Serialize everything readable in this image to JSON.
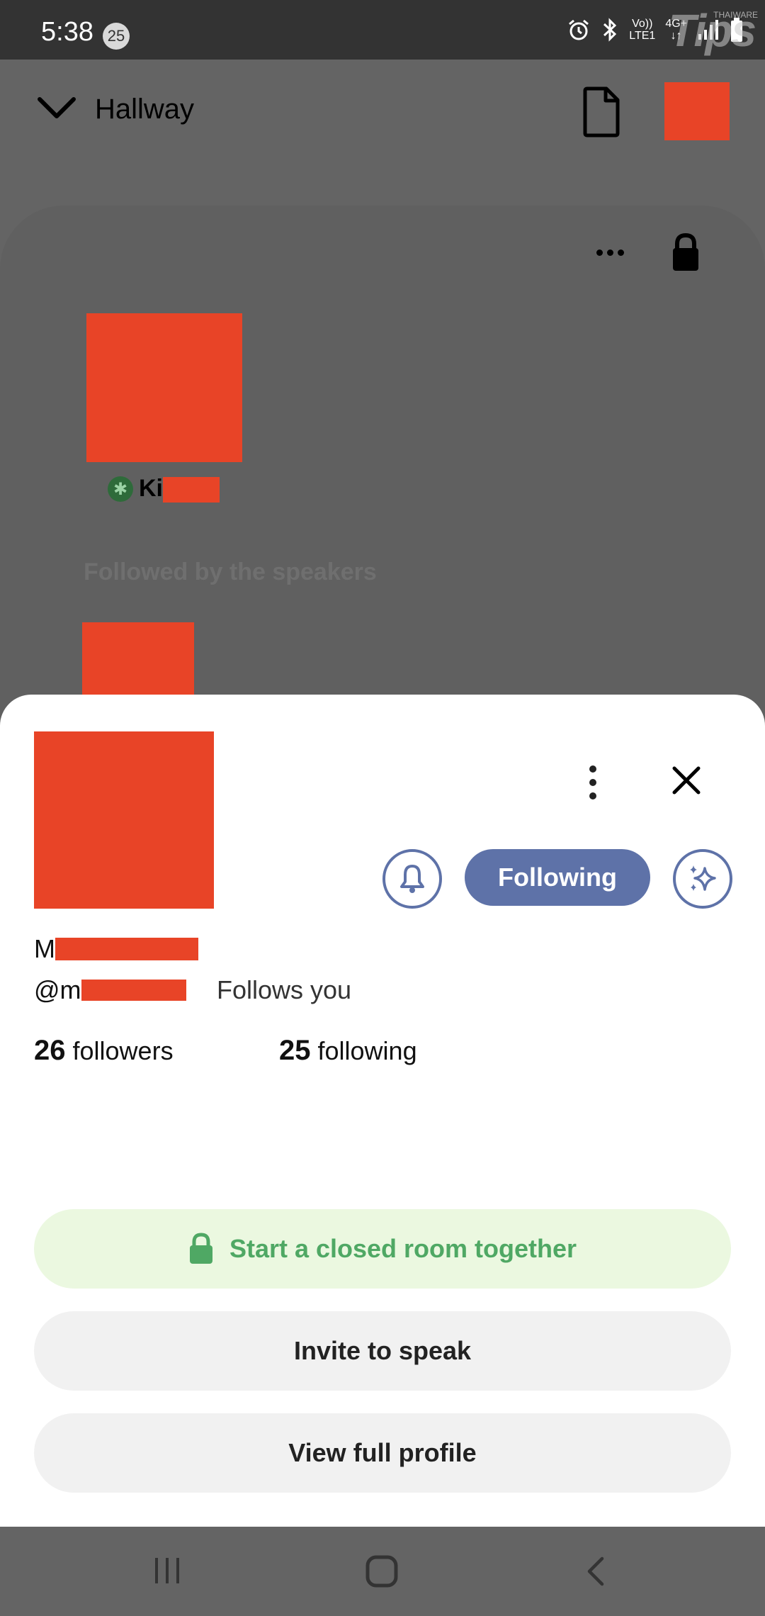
{
  "status_bar": {
    "time": "5:38",
    "notification_count": "25",
    "network_top": "Vo))",
    "network_bottom": "LTE1",
    "data_type": "4G+",
    "watermark_brand": "THAIWARE",
    "watermark_text": "Tips"
  },
  "header": {
    "title": "Hallway"
  },
  "room": {
    "speaker_name_prefix": "Ki",
    "followed_by_label": "Followed by the speakers"
  },
  "profile": {
    "name_prefix": "M",
    "handle_prefix": "@m",
    "follows_you": "Follows you",
    "followers_count": "26",
    "followers_label": "followers",
    "following_count": "25",
    "following_label": "following",
    "following_button": "Following"
  },
  "actions": {
    "closed_room": "Start a closed room together",
    "invite": "Invite to speak",
    "view_profile": "View full profile"
  },
  "colors": {
    "accent": "#5e72a8",
    "closed_room_bg": "#ebf8e0",
    "closed_room_text": "#4fa864",
    "redaction": "#e84427"
  },
  "icons": {
    "back": "chevron-down-icon",
    "document": "document-icon",
    "lock": "lock-icon",
    "bell": "bell-icon",
    "sparkle": "sparkle-icon",
    "close": "close-icon"
  }
}
